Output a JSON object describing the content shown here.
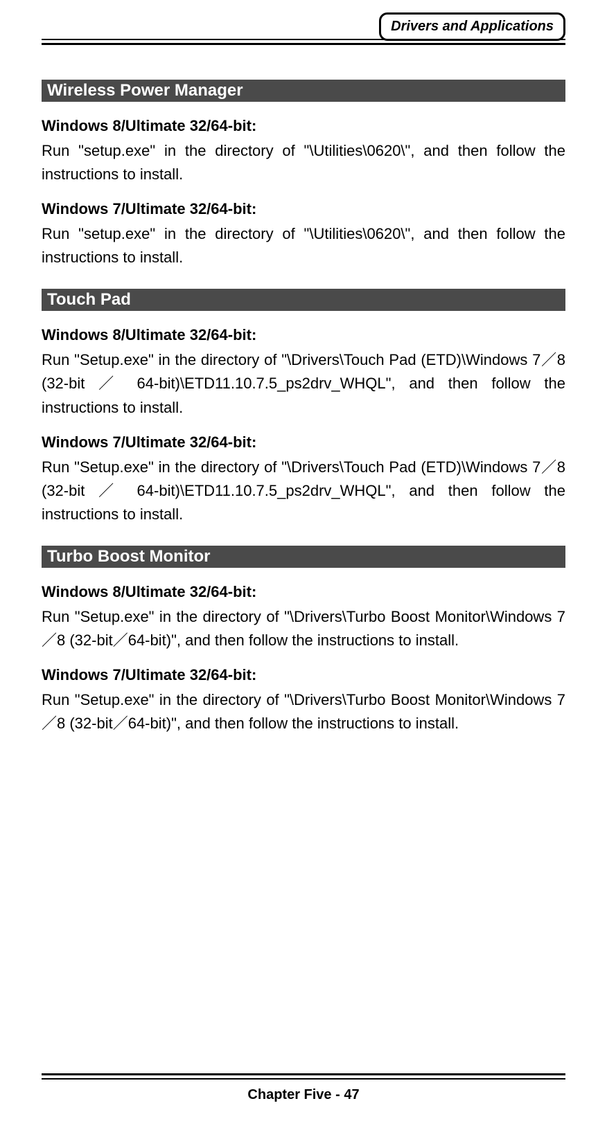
{
  "header": {
    "label": "Drivers and Applications"
  },
  "sections": [
    {
      "title": " Wireless Power Manager",
      "blocks": [
        {
          "heading": "Windows 8/Ultimate 32/64-bit:",
          "body": "Run \"setup.exe\" in the directory of \"\\Utilities\\0620\\\", and then follow the instructions to install."
        },
        {
          "heading": "Windows 7/Ultimate 32/64-bit:",
          "body": "Run \"setup.exe\" in the directory of \"\\Utilities\\0620\\\", and then follow the instructions to install."
        }
      ]
    },
    {
      "title": " Touch Pad",
      "blocks": [
        {
          "heading": "Windows 8/Ultimate 32/64-bit:",
          "body": "Run \"Setup.exe\" in the directory of \"\\Drivers\\Touch Pad (ETD)\\Windows 7／8 (32-bit ／ 64-bit)\\ETD11.10.7.5_ps2drv_WHQL\", and then follow the instructions to install."
        },
        {
          "heading": "Windows 7/Ultimate 32/64-bit:",
          "body": "Run \"Setup.exe\" in the directory of \"\\Drivers\\Touch Pad (ETD)\\Windows 7／8 (32-bit ／ 64-bit)\\ETD11.10.7.5_ps2drv_WHQL\", and then follow the instructions to install."
        }
      ]
    },
    {
      "title": " Turbo Boost Monitor",
      "blocks": [
        {
          "heading": "Windows 8/Ultimate 32/64-bit:",
          "body": "Run \"Setup.exe\" in the directory of \"\\Drivers\\Turbo Boost Monitor\\Windows 7／8 (32-bit／64-bit)\", and then follow the instructions to install."
        },
        {
          "heading": "Windows 7/Ultimate 32/64-bit:",
          "body": "Run \"Setup.exe\" in the directory of \"\\Drivers\\Turbo Boost Monitor\\Windows 7／8 (32-bit／64-bit)\", and then follow the instructions to install."
        }
      ]
    }
  ],
  "footer": {
    "text": "Chapter Five - 47"
  }
}
